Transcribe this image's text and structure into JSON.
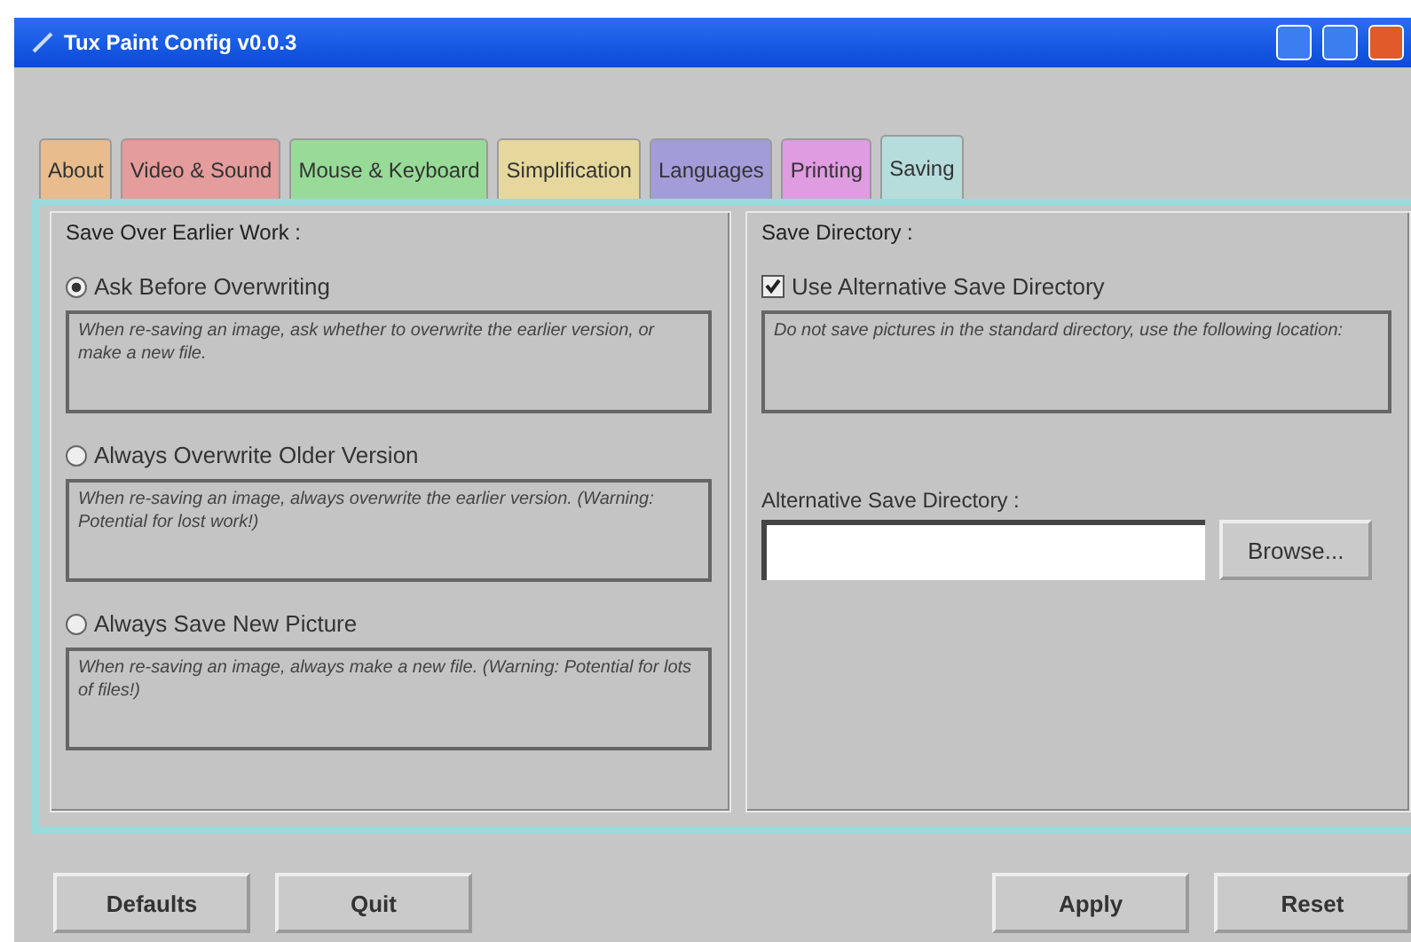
{
  "window": {
    "title": "Tux Paint Config v0.0.3"
  },
  "tabs": [
    {
      "label": "About",
      "selected": false,
      "color": "#e8bc8c"
    },
    {
      "label": "Video & Sound",
      "selected": false,
      "color": "#e49c9c"
    },
    {
      "label": "Mouse & Keyboard",
      "selected": false,
      "color": "#98da98"
    },
    {
      "label": "Simplification",
      "selected": false,
      "color": "#e6d89c"
    },
    {
      "label": "Languages",
      "selected": false,
      "color": "#a29cd8"
    },
    {
      "label": "Printing",
      "selected": false,
      "color": "#df9ce0"
    },
    {
      "label": "Saving",
      "selected": true,
      "color": "#b6dcdc"
    }
  ],
  "save_over": {
    "heading": "Save Over Earlier Work :",
    "options": [
      {
        "label": "Ask Before Overwriting",
        "selected": true,
        "description": "When re-saving an image, ask whether to overwrite the earlier version, or make a new file."
      },
      {
        "label": "Always Overwrite Older Version",
        "selected": false,
        "description": "When re-saving an image, always overwrite the earlier version. (Warning: Potential for lost work!)"
      },
      {
        "label": "Always Save New Picture",
        "selected": false,
        "description": "When re-saving an image, always make a new file. (Warning: Potential for lots of files!)"
      }
    ]
  },
  "save_directory": {
    "heading": "Save Directory :",
    "checkbox": {
      "label": "Use Alternative Save Directory",
      "checked": true
    },
    "description": "Do not save pictures in the standard directory, use the following location:",
    "field_label": "Alternative Save Directory :",
    "browse_button": "Browse..."
  },
  "buttons_left": [
    "Defaults",
    "Quit"
  ],
  "buttons_right": [
    "Apply",
    "Reset"
  ]
}
